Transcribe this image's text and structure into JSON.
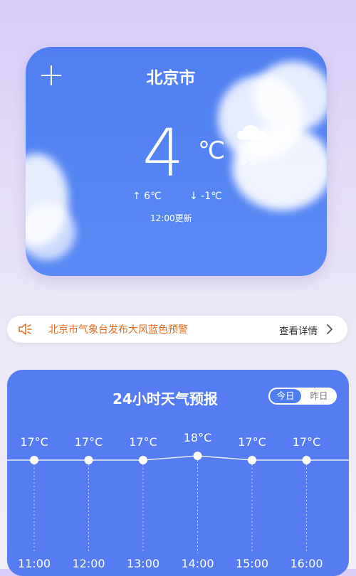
{
  "weather": {
    "city": "北京市",
    "temperature": "4",
    "unit": "℃",
    "condition": "多云",
    "high": "↑ 6℃",
    "low": "↓ -1℃",
    "updated": "12:00更新"
  },
  "alert": {
    "text": "北京市气象台发布大风蓝色预警",
    "more_label": "查看详情"
  },
  "forecast": {
    "title": "24小时天气预报",
    "toggle_today": "今日",
    "toggle_yesterday": "昨日",
    "hours": [
      {
        "time": "11:00",
        "temp": "17°C",
        "value": 17
      },
      {
        "time": "12:00",
        "temp": "17°C",
        "value": 17
      },
      {
        "time": "13:00",
        "temp": "17°C",
        "value": 17
      },
      {
        "time": "14:00",
        "temp": "18°C",
        "value": 18
      },
      {
        "time": "15:00",
        "temp": "17°C",
        "value": 17
      },
      {
        "time": "16:00",
        "temp": "17°C",
        "value": 17
      }
    ]
  },
  "colors": {
    "accent": "#557cf3",
    "alert_text": "#e06a1e"
  }
}
